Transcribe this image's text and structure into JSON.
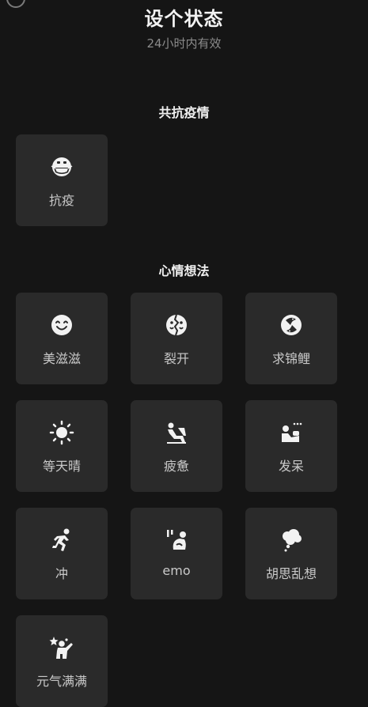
{
  "header": {
    "title": "设个状态",
    "subtitle": "24小时内有效"
  },
  "sections": [
    {
      "title": "共抗疫情",
      "items": [
        {
          "label": "抗疫",
          "icon": "mask-face-icon"
        }
      ]
    },
    {
      "title": "心情想法",
      "items": [
        {
          "label": "美滋滋",
          "icon": "smiley-face-icon"
        },
        {
          "label": "裂开",
          "icon": "cracked-face-icon"
        },
        {
          "label": "求锦鲤",
          "icon": "koi-fish-icon"
        },
        {
          "label": "等天晴",
          "icon": "sun-icon"
        },
        {
          "label": "疲惫",
          "icon": "tired-person-icon"
        },
        {
          "label": "发呆",
          "icon": "daydream-person-icon"
        },
        {
          "label": "冲",
          "icon": "running-person-icon"
        },
        {
          "label": "emo",
          "icon": "emo-person-icon"
        },
        {
          "label": "胡思乱想",
          "icon": "thought-bubble-icon"
        },
        {
          "label": "元气满满",
          "icon": "energetic-person-icon"
        }
      ]
    }
  ],
  "colors": {
    "background": "#151515",
    "tile": "#2a2a2a",
    "icon": "#f2f2f2"
  }
}
